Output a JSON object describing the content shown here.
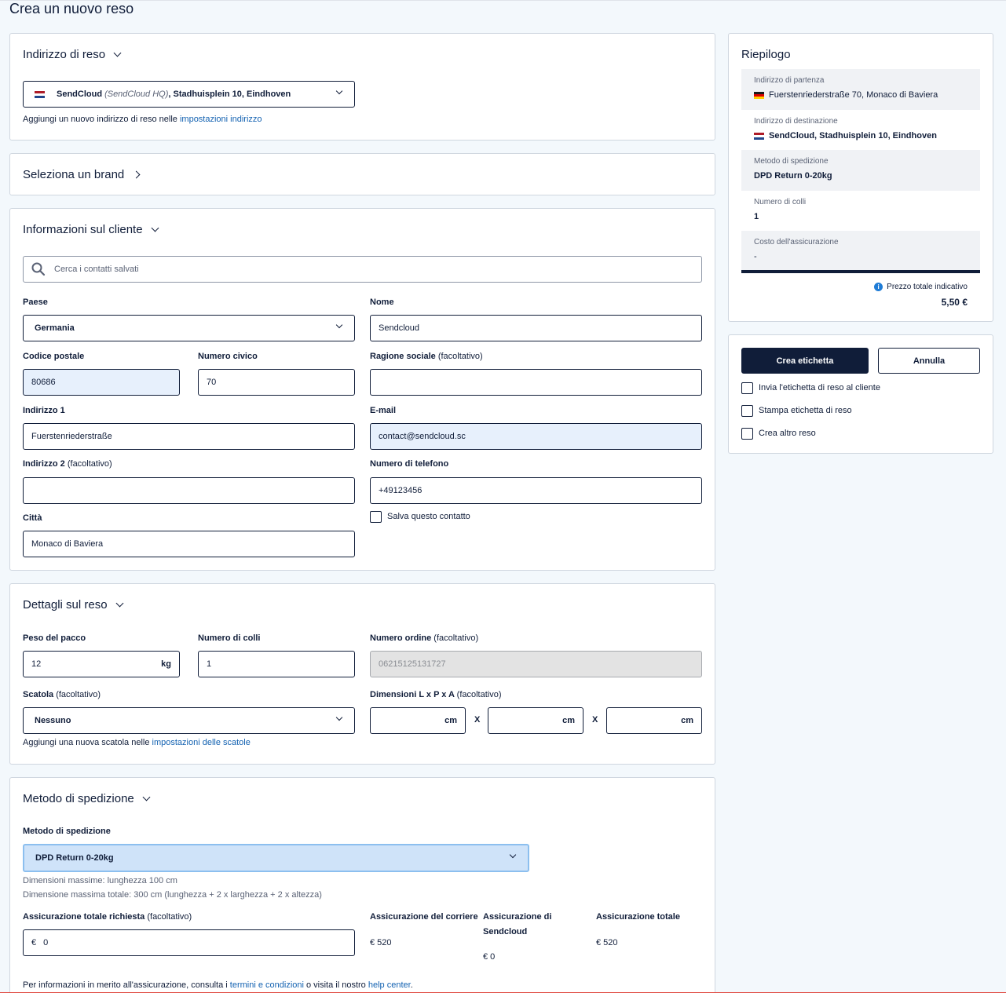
{
  "page": {
    "title": "Crea un nuovo reso"
  },
  "return_address": {
    "title": "Indirizzo di reso",
    "select_name": "SendCloud",
    "select_alias": "(SendCloud HQ)",
    "select_address": ", Stadhuisplein 10, Eindhoven",
    "hint_prefix": "Aggiungi un nuovo indirizzo di reso nelle ",
    "hint_link": "impostazioni indirizzo"
  },
  "brand": {
    "title": "Seleziona un brand"
  },
  "customer": {
    "title": "Informazioni sul cliente",
    "search_placeholder": "Cerca i contatti salvati",
    "country_label": "Paese",
    "country_value": "Germania",
    "name_label": "Nome",
    "name_value": "Sendcloud",
    "postal_label": "Codice postale",
    "postal_value": "80686",
    "house_label": "Numero civico",
    "house_value": "70",
    "company_label": "Ragione sociale",
    "company_optional": "(facoltativo)",
    "company_value": "",
    "address1_label": "Indirizzo 1",
    "address1_value": "Fuerstenriederstraße",
    "email_label": "E-mail",
    "email_value": "contact@sendcloud.sc",
    "address2_label": "Indirizzo 2",
    "address2_optional": "(facoltativo)",
    "address2_value": "",
    "phone_label": "Numero di telefono",
    "phone_value": "+49123456",
    "save_contact_label": "Salva questo contatto",
    "city_label": "Città",
    "city_value": "Monaco di Baviera"
  },
  "details": {
    "title": "Dettagli sul reso",
    "weight_label": "Peso del pacco",
    "weight_value": "12",
    "weight_unit": "kg",
    "parcels_label": "Numero di colli",
    "parcels_value": "1",
    "order_label": "Numero ordine",
    "order_optional": "(facoltativo)",
    "order_value": "06215125131727",
    "box_label": "Scatola",
    "box_optional": "(facoltativo)",
    "box_value": "Nessuno",
    "dims_label": "Dimensioni L x P x A",
    "dims_optional": "(facoltativo)",
    "dim_unit": "cm",
    "dim_sep": "X",
    "box_hint_prefix": "Aggiungi una nuova scatola nelle ",
    "box_hint_link": "impostazioni delle scatole"
  },
  "shipping": {
    "title": "Metodo di spedizione",
    "method_label": "Metodo di spedizione",
    "method_value": "DPD Return 0-20kg",
    "max_dims": "Dimensioni massime: lunghezza 100 cm",
    "max_total": "Dimensione massima totale: 300 cm (lunghezza + 2 x larghezza + 2 x altezza)",
    "insurance_label": "Assicurazione totale richiesta",
    "insurance_optional": "(facoltativo)",
    "insurance_currency": "€",
    "insurance_value": "0",
    "carrier_ins_label": "Assicurazione del corriere",
    "carrier_ins_value": "€ 520",
    "sendcloud_ins_label_1": "Assicurazione di",
    "sendcloud_ins_label_2": "Sendcloud",
    "sendcloud_ins_value": "€ 0",
    "total_ins_label": "Assicurazione totale",
    "total_ins_value": "€ 520",
    "footer_prefix": "Per informazioni in merito all'assicurazione, consulta i ",
    "footer_link1": "termini e condizioni",
    "footer_mid": " o visita il nostro ",
    "footer_link2": "help center",
    "footer_end": "."
  },
  "summary": {
    "title": "Riepilogo",
    "from_label": "Indirizzo di partenza",
    "from_value": "Fuerstenriederstraße 70, Monaco di Baviera",
    "to_label": "Indirizzo di destinazione",
    "to_value": "SendCloud, Stadhuisplein 10, Eindhoven",
    "method_label": "Metodo di spedizione",
    "method_value": "DPD Return 0-20kg",
    "parcels_label": "Numero di colli",
    "parcels_value": "1",
    "insurance_label": "Costo dell'assicurazione",
    "insurance_value": "-",
    "total_label": "Prezzo totale indicativo",
    "total_value": "5,50 €"
  },
  "actions": {
    "create_label": "Crea etichetta",
    "cancel_label": "Annulla",
    "send_label": "Invia l'etichetta di reso al cliente",
    "print_label": "Stampa etichetta di reso",
    "another_label": "Crea altro reso"
  },
  "colors": {
    "primary": "#101d39",
    "link": "#1261b1",
    "filled": "#e7f0fc",
    "focus": "#cfe3f9"
  }
}
